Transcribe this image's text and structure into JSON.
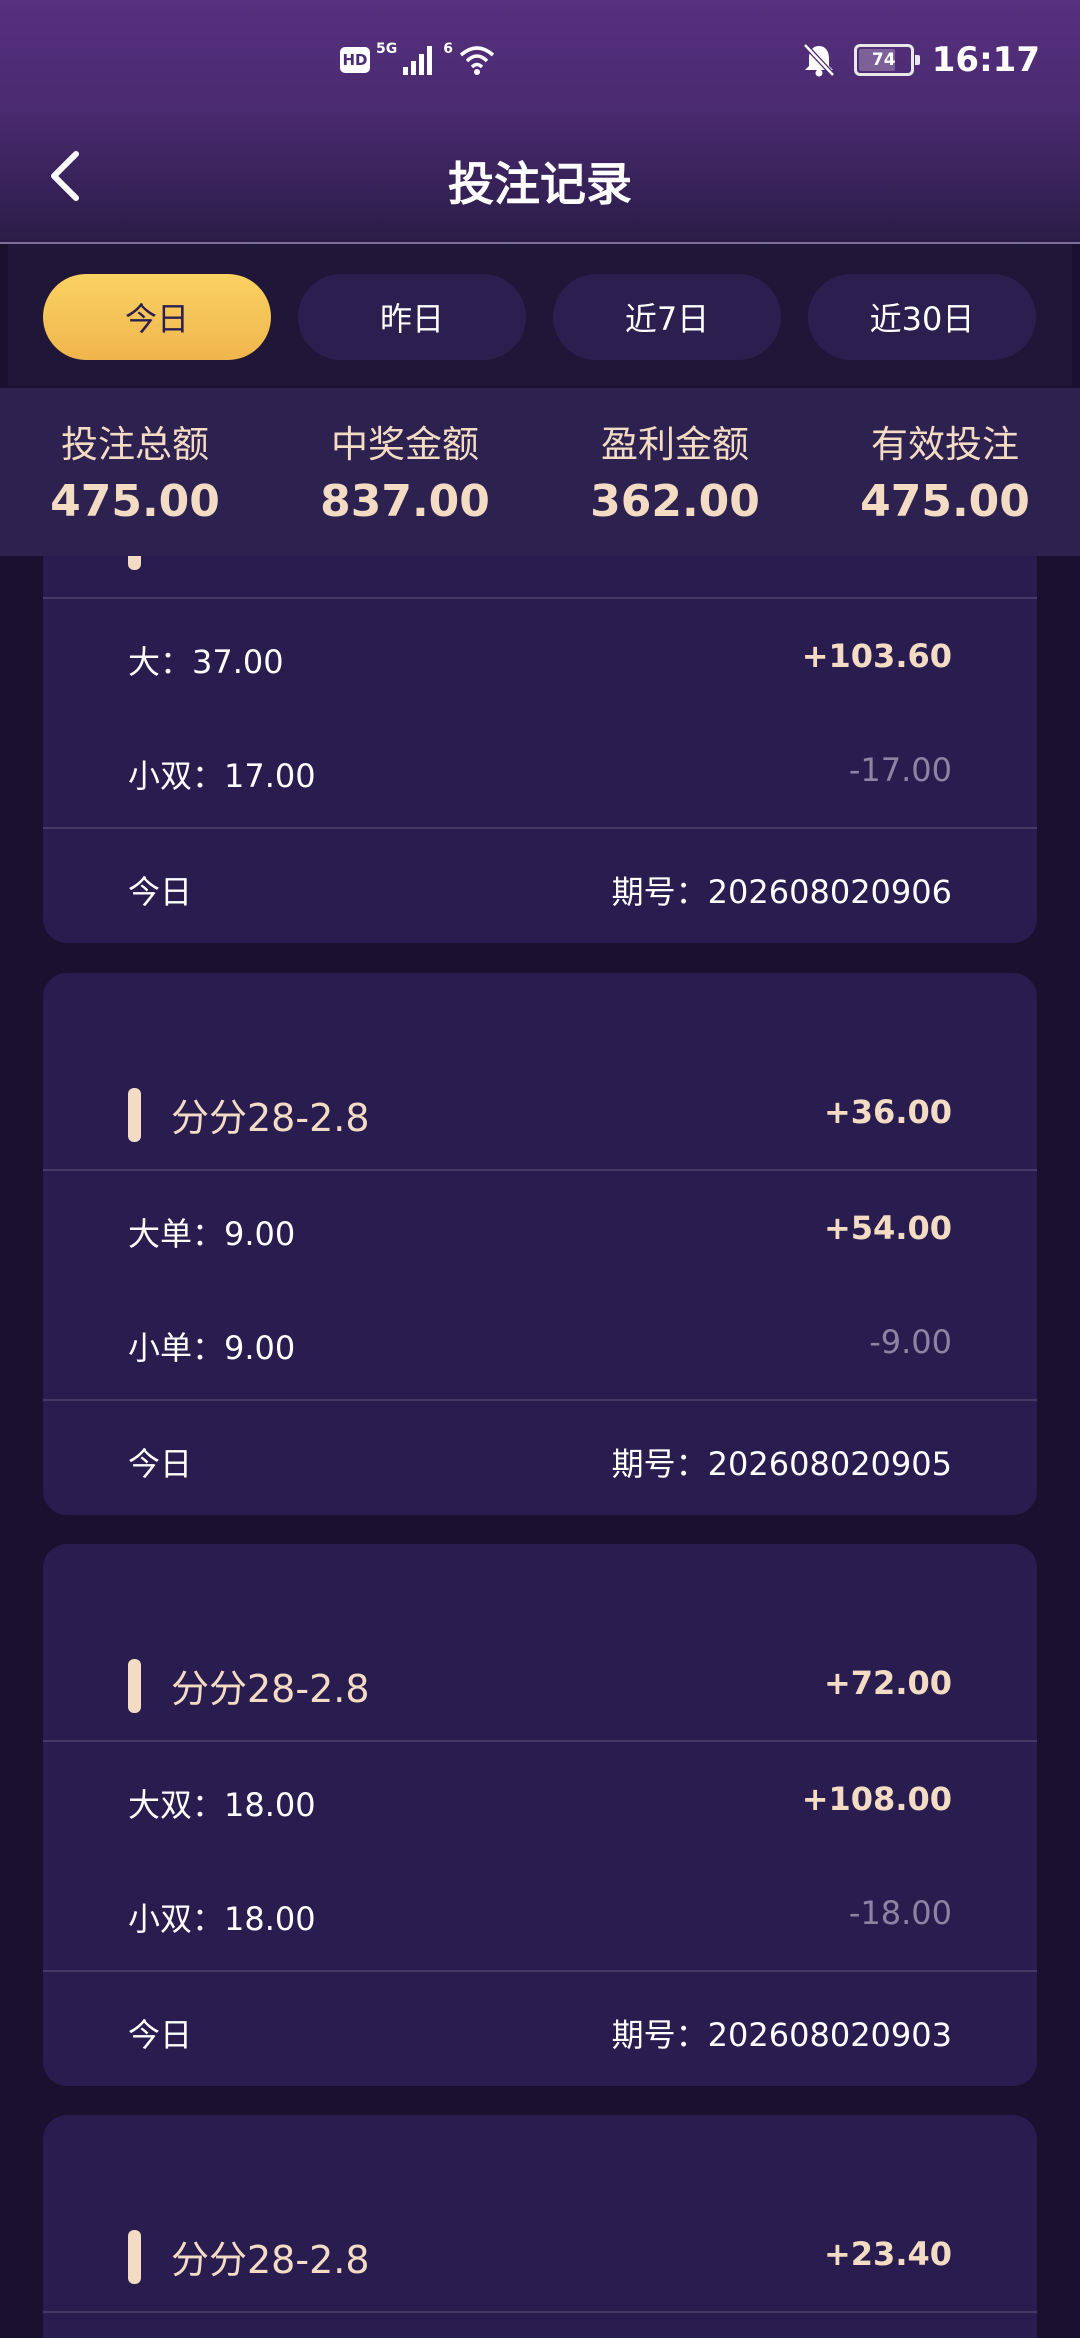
{
  "status_bar": {
    "hd": "HD",
    "network": "5G",
    "wifi_badge": "6",
    "battery": "74",
    "time": "16:17"
  },
  "header": {
    "title": "投注记录"
  },
  "tabs": [
    {
      "label": "今日",
      "active": true
    },
    {
      "label": "昨日",
      "active": false
    },
    {
      "label": "近7日",
      "active": false
    },
    {
      "label": "近30日",
      "active": false
    }
  ],
  "summary": [
    {
      "label": "投注总额",
      "value": "475.00"
    },
    {
      "label": "中奖金额",
      "value": "837.00"
    },
    {
      "label": "盈利金额",
      "value": "362.00"
    },
    {
      "label": "有效投注",
      "value": "475.00"
    }
  ],
  "cards": [
    {
      "game": "",
      "total": "",
      "bets": [
        {
          "label": "大：37.00",
          "amount": "+103.60",
          "win": true
        },
        {
          "label": "小双：17.00",
          "amount": "-17.00",
          "win": false
        }
      ],
      "day": "今日",
      "issue": "期号：202608020906"
    },
    {
      "game": "分分28-2.8",
      "total": "+36.00",
      "bets": [
        {
          "label": "大单：9.00",
          "amount": "+54.00",
          "win": true
        },
        {
          "label": "小单：9.00",
          "amount": "-9.00",
          "win": false
        }
      ],
      "day": "今日",
      "issue": "期号：202608020905"
    },
    {
      "game": "分分28-2.8",
      "total": "+72.00",
      "bets": [
        {
          "label": "大双：18.00",
          "amount": "+108.00",
          "win": true
        },
        {
          "label": "小双：18.00",
          "amount": "-18.00",
          "win": false
        }
      ],
      "day": "今日",
      "issue": "期号：202608020903"
    },
    {
      "game": "分分28-2.8",
      "total": "+23.40",
      "bets": [],
      "day": "",
      "issue": ""
    }
  ],
  "colors": {
    "background": "#19112f",
    "card": "#291d50",
    "accent_gold": "#f3dcc3",
    "tab_active": "#f8c95a",
    "loss_gray": "#8c84a3"
  }
}
